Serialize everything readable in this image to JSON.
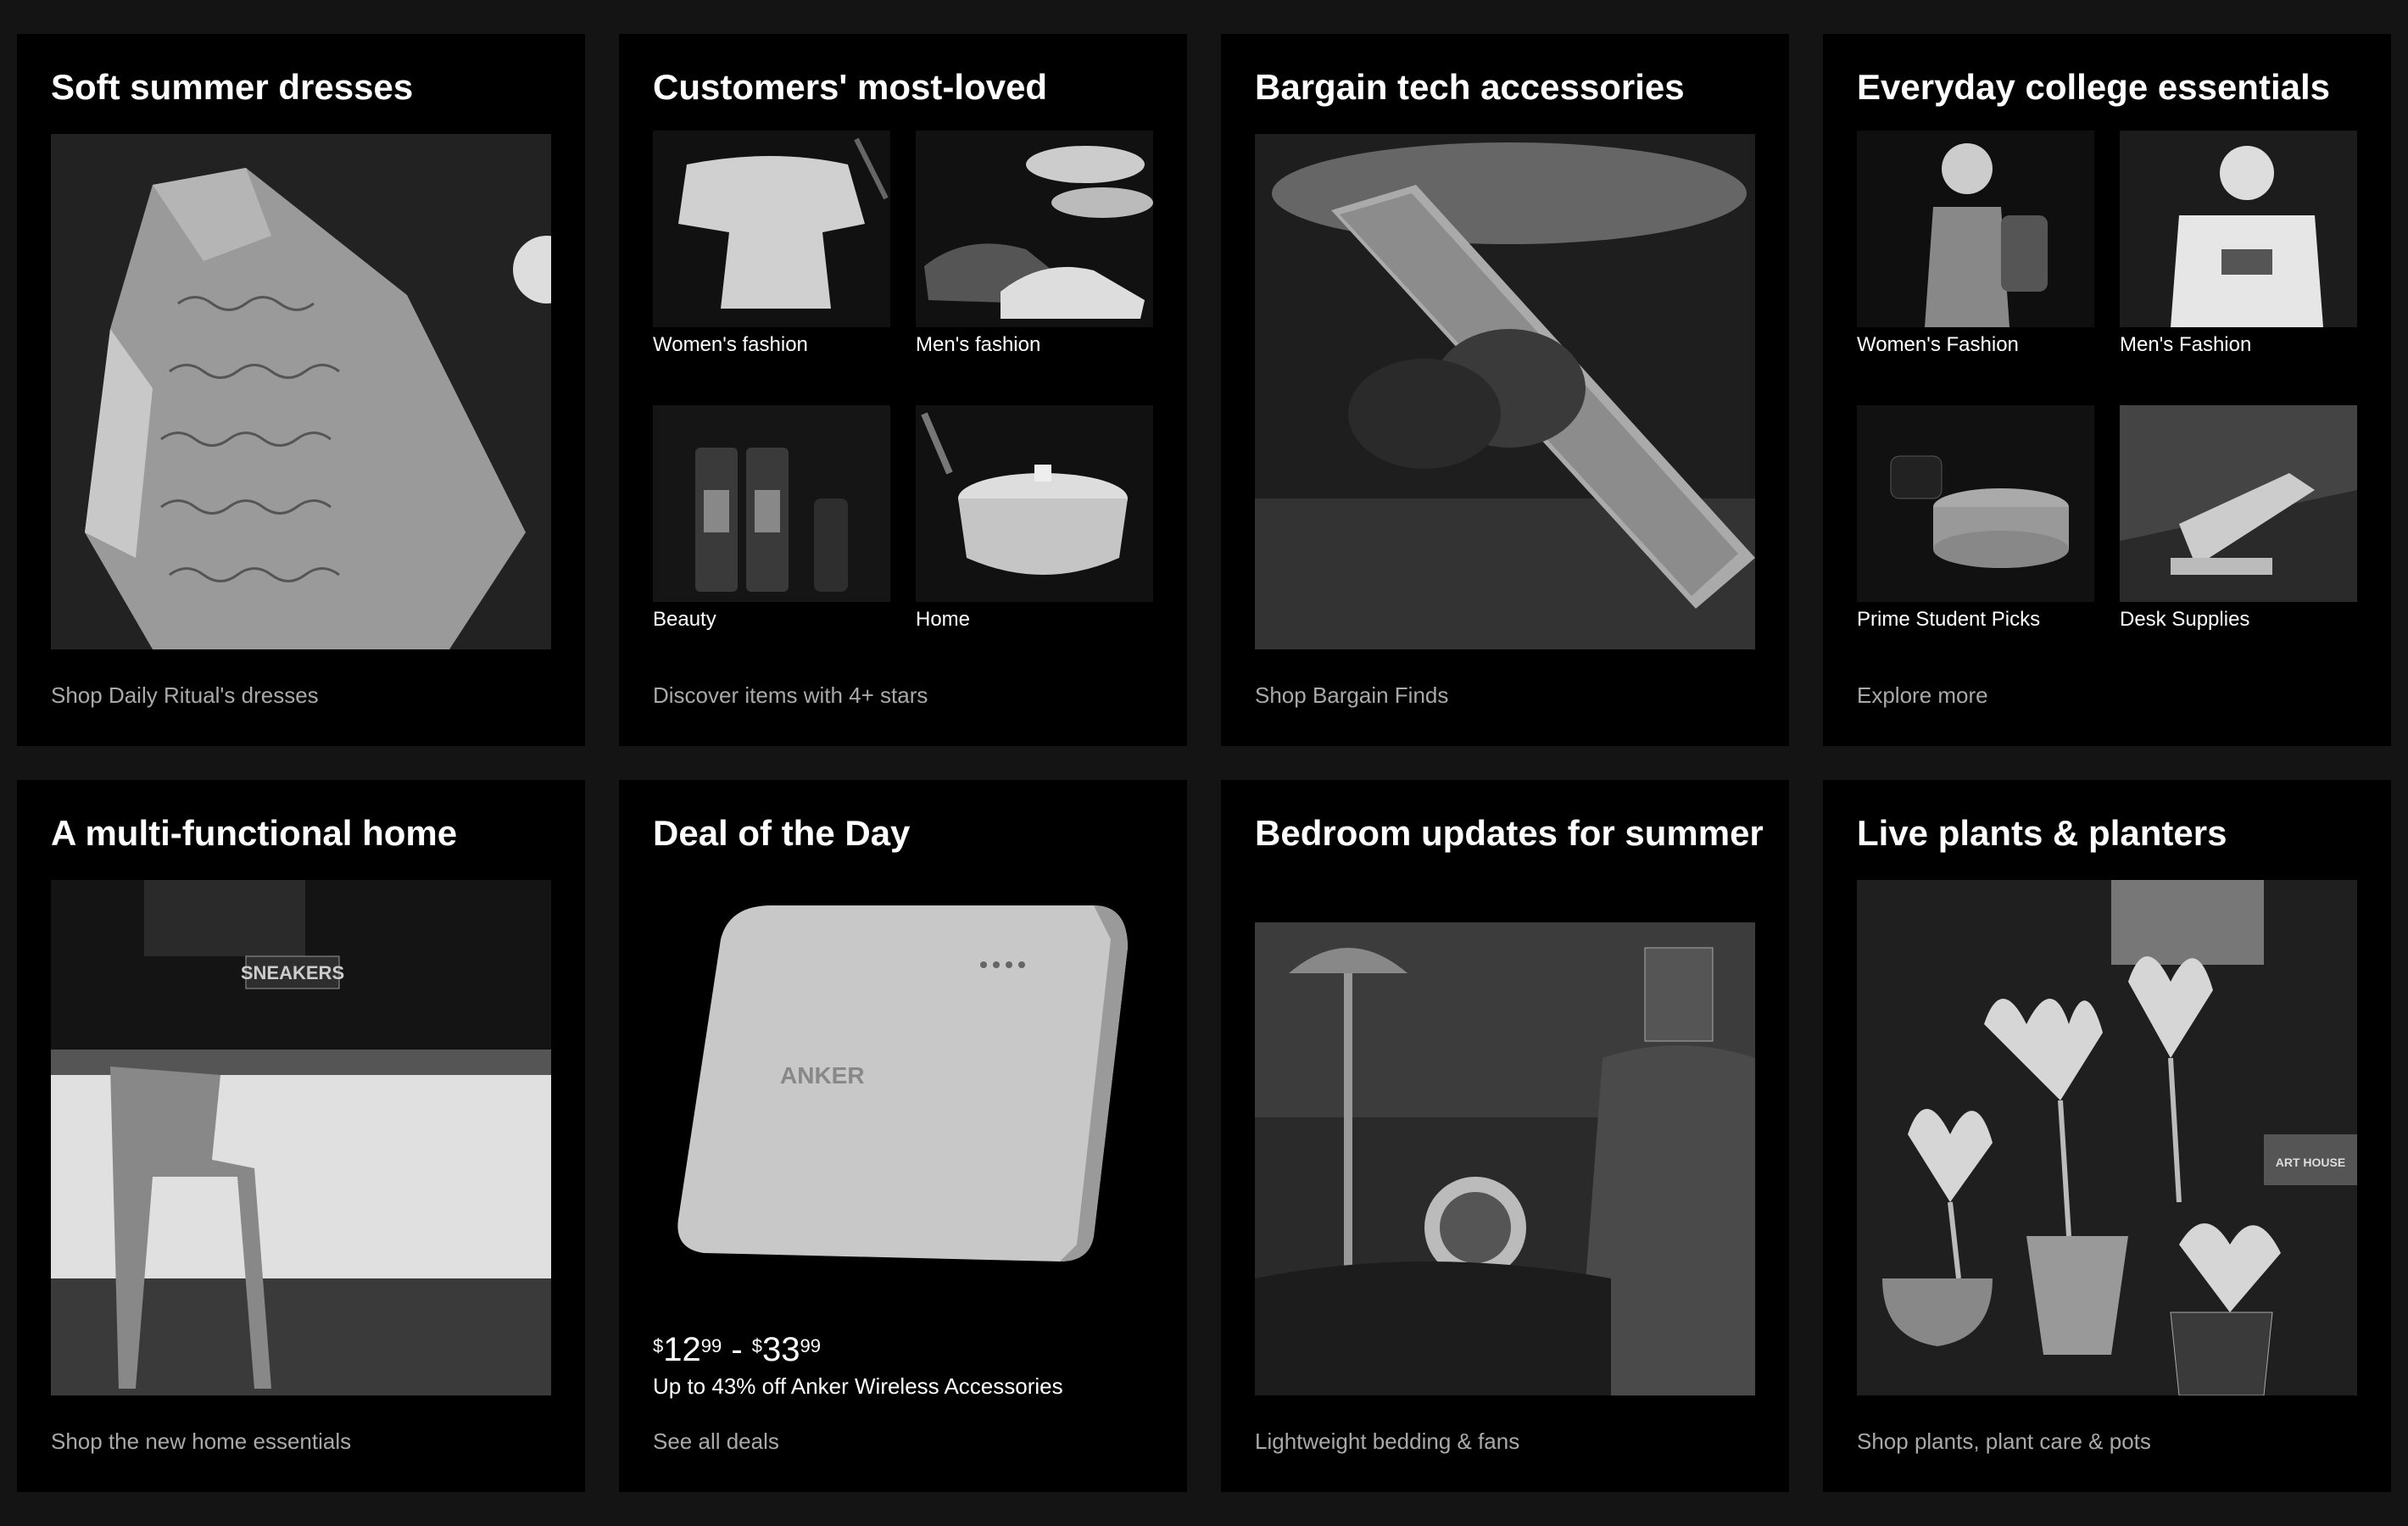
{
  "cards": [
    {
      "title": "Soft summer dresses",
      "link": "Shop Daily Ritual's dresses"
    },
    {
      "title": "Customers' most-loved",
      "items": [
        {
          "label": "Women's fashion"
        },
        {
          "label": "Men's fashion"
        },
        {
          "label": "Beauty"
        },
        {
          "label": "Home"
        }
      ],
      "link": "Discover items with 4+ stars"
    },
    {
      "title": "Bargain tech accessories",
      "link": "Shop Bargain Finds"
    },
    {
      "title": "Everyday college essentials",
      "items": [
        {
          "label": "Women's Fashion"
        },
        {
          "label": "Men's Fashion"
        },
        {
          "label": "Prime Student Picks"
        },
        {
          "label": "Desk Supplies"
        }
      ],
      "link": "Explore more"
    },
    {
      "title": "A multi-functional home",
      "link": "Shop the new home essentials"
    },
    {
      "title": "Deal of the Day",
      "price": {
        "currency": "$",
        "low_whole": "12",
        "low_cents": "99",
        "separator": " - ",
        "high_whole": "33",
        "high_cents": "99"
      },
      "description": "Up to 43% off Anker Wireless Accessories",
      "product_brand": "ANKER",
      "link": "See all deals"
    },
    {
      "title": "Bedroom updates for summer",
      "link": "Lightweight bedding & fans"
    },
    {
      "title": "Live plants & planters",
      "link": "Shop plants, plant care & pots"
    }
  ],
  "image_text": {
    "sneakers_sign": "SNEAKERS",
    "book_1": "ART HOUSE"
  },
  "colors": {
    "page_bg": "#141414",
    "card_bg": "#000000",
    "link_text": "#a9a9a9"
  }
}
